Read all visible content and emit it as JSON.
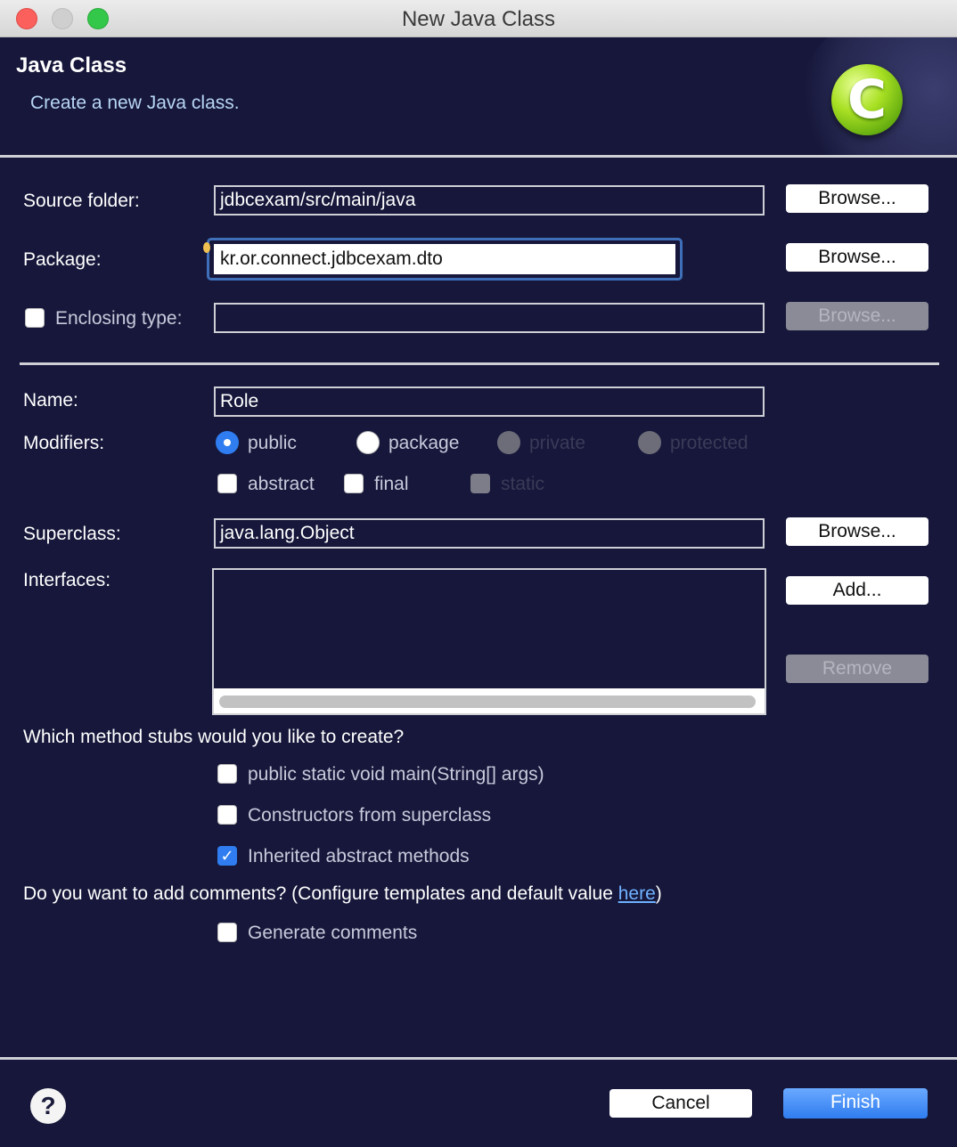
{
  "window": {
    "title": "New Java Class"
  },
  "header": {
    "title": "Java Class",
    "subtitle": "Create a new Java class.",
    "logo_letter": "C",
    "logo_icon": "java-class-icon"
  },
  "form": {
    "source_folder": {
      "label": "Source folder:",
      "value": "jdbcexam/src/main/java",
      "browse_label": "Browse..."
    },
    "package": {
      "label": "Package:",
      "value": "kr.or.connect.jdbcexam.dto",
      "browse_label": "Browse..."
    },
    "enclosing_type": {
      "label": "Enclosing type:",
      "value": "",
      "checked": false,
      "browse_label": "Browse..."
    },
    "name": {
      "label": "Name:",
      "value": "Role"
    },
    "modifiers": {
      "label": "Modifiers:",
      "visibility": [
        {
          "label": "public",
          "selected": true,
          "enabled": true
        },
        {
          "label": "package",
          "selected": false,
          "enabled": true
        },
        {
          "label": "private",
          "selected": false,
          "enabled": false
        },
        {
          "label": "protected",
          "selected": false,
          "enabled": false
        }
      ],
      "flags": [
        {
          "label": "abstract",
          "checked": false,
          "enabled": true
        },
        {
          "label": "final",
          "checked": false,
          "enabled": true
        },
        {
          "label": "static",
          "checked": false,
          "enabled": false
        }
      ]
    },
    "superclass": {
      "label": "Superclass:",
      "value": "java.lang.Object",
      "browse_label": "Browse..."
    },
    "interfaces": {
      "label": "Interfaces:",
      "add_label": "Add...",
      "remove_label": "Remove",
      "items": []
    },
    "method_stubs": {
      "question": "Which method stubs would you like to create?",
      "options": [
        {
          "label": "public static void main(String[] args)",
          "checked": false
        },
        {
          "label": "Constructors from superclass",
          "checked": false
        },
        {
          "label": "Inherited abstract methods",
          "checked": true
        }
      ]
    },
    "comments": {
      "question_prefix": "Do you want to add comments? (Configure templates and default value ",
      "link_text": "here",
      "question_suffix": ")",
      "generate_label": "Generate comments",
      "generate_checked": false
    }
  },
  "footer": {
    "help_symbol": "?",
    "cancel_label": "Cancel",
    "finish_label": "Finish"
  },
  "colors": {
    "background": "#16173a",
    "accent": "#2f7df0",
    "link": "#6fb1ff"
  }
}
